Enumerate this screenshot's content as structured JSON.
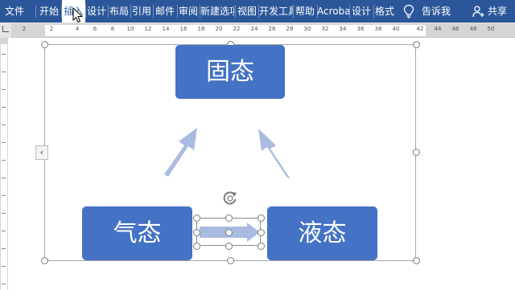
{
  "ribbon": {
    "tabs": [
      {
        "label": "文件",
        "active": false
      },
      {
        "label": "开始",
        "active": false
      },
      {
        "label": "插入",
        "active": true
      },
      {
        "label": "设计",
        "active": false
      },
      {
        "label": "布局",
        "active": false
      },
      {
        "label": "引用",
        "active": false
      },
      {
        "label": "邮件",
        "active": false
      },
      {
        "label": "审阅",
        "active": false
      },
      {
        "label": "新建选项",
        "active": false
      },
      {
        "label": "视图",
        "active": false
      },
      {
        "label": "开发工具",
        "active": false
      },
      {
        "label": "帮助",
        "active": false
      },
      {
        "label": "Acrobat",
        "active": false
      },
      {
        "label": "设计",
        "active": false
      },
      {
        "label": "格式",
        "active": false
      }
    ],
    "tell_me": "告诉我",
    "share": "共享"
  },
  "ruler": {
    "ticks": [
      "2",
      "2",
      "4",
      "6",
      "8",
      "10",
      "12",
      "14",
      "16",
      "18",
      "20",
      "22",
      "24",
      "26",
      "28",
      "30",
      "32",
      "34",
      "36",
      "38",
      "40",
      "42",
      "44",
      "46",
      "48",
      "50"
    ]
  },
  "smartart": {
    "nodes": {
      "top": "固态",
      "bottom_left": "气态",
      "bottom_right": "液态"
    },
    "collapse_glyph": "‹"
  },
  "colors": {
    "ribbon_bg": "#2b579a",
    "node_fill": "#4472c4",
    "arrow_fill": "#a9bbe0"
  }
}
